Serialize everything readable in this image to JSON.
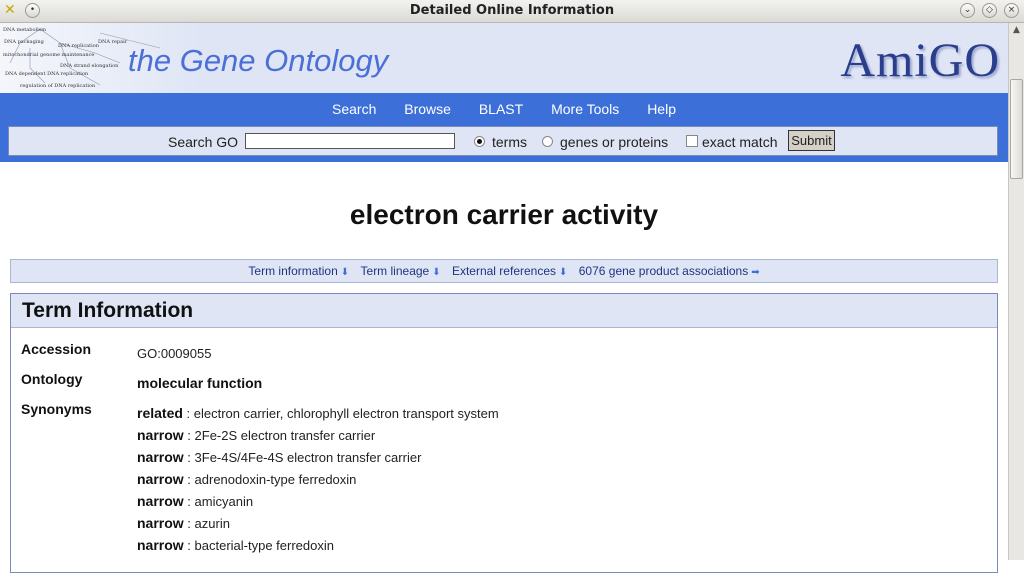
{
  "window": {
    "title": "Detailed Online Information"
  },
  "header": {
    "site_title": "the Gene Ontology",
    "logo": "AmiGO",
    "graph_labels": [
      "DNA metabolism",
      "DNA packaging",
      "DNA replication",
      "DNA repair",
      "mitochondrial genome maintenance",
      "DNA dependent DNA replication",
      "DNA strand elongation",
      "regulation of DNA replication"
    ]
  },
  "nav": {
    "items": [
      "Search",
      "Browse",
      "BLAST",
      "More Tools",
      "Help"
    ]
  },
  "search": {
    "label": "Search GO",
    "input_value": "",
    "options": {
      "terms": "terms",
      "genes": "genes or proteins",
      "exact": "exact match"
    },
    "selected": "terms",
    "exact_checked": false,
    "submit": "Submit"
  },
  "page": {
    "title": "electron carrier activity"
  },
  "jump_links": [
    "Term information",
    "Term lineage",
    "External references",
    "6076 gene product associations"
  ],
  "term_info": {
    "heading": "Term Information",
    "accession_label": "Accession",
    "accession": "GO:0009055",
    "ontology_label": "Ontology",
    "ontology": "molecular function",
    "synonyms_label": "Synonyms",
    "synonyms": [
      {
        "type": "related",
        "text": "electron carrier, chlorophyll electron transport system"
      },
      {
        "type": "narrow",
        "text": "2Fe-2S electron transfer carrier"
      },
      {
        "type": "narrow",
        "text": "3Fe-4S/4Fe-4S electron transfer carrier"
      },
      {
        "type": "narrow",
        "text": "adrenodoxin-type ferredoxin"
      },
      {
        "type": "narrow",
        "text": "amicyanin"
      },
      {
        "type": "narrow",
        "text": "azurin"
      },
      {
        "type": "narrow",
        "text": "bacterial-type ferredoxin"
      }
    ]
  },
  "colors": {
    "nav_blue": "#3d6fd8",
    "panel_bg": "#dfe5f5",
    "link": "#1f3580"
  },
  "icons": {
    "down_arrow": "arrow-down-icon",
    "right_arrow": "arrow-right-icon"
  }
}
